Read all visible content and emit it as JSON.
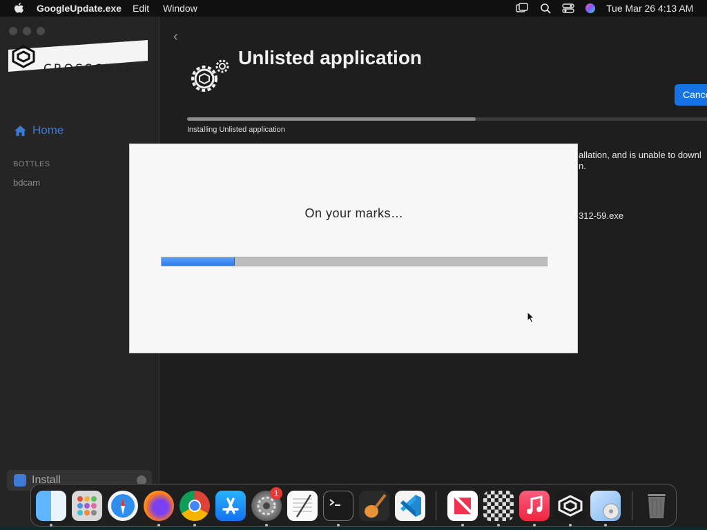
{
  "menubar": {
    "app_name": "GoogleUpdate.exe",
    "menus": [
      "Edit",
      "Window"
    ],
    "clock": "Tue Mar 26  4:13 AM",
    "icons": [
      "apple-icon",
      "screen-mirror-icon",
      "search-icon",
      "control-center-icon",
      "siri-icon"
    ]
  },
  "sidebar": {
    "logo_text": "CROSSOVER",
    "home_label": "Home",
    "section_label": "BOTTLES",
    "bottles": [
      "bdcam"
    ],
    "install_label": "Install"
  },
  "main": {
    "title": "Unlisted application",
    "cancel_label": "Cance",
    "status": "Installing Unlisted application",
    "progress": 0.55,
    "bg_text_line1": "allation, and is unable to downl",
    "bg_text_line2": "n.",
    "bg_text_line3": "312-59.exe"
  },
  "dialog": {
    "message": "On your marks…",
    "progress": 0.19
  },
  "dock": {
    "apps": [
      "Finder",
      "Launchpad",
      "Safari",
      "Firefox",
      "Chrome",
      "App Store",
      "System Settings",
      "TextEdit",
      "Terminal",
      "GarageBand",
      "VS Code",
      "News",
      "Chess",
      "Music",
      "CrossOver",
      "Installer",
      "Trash"
    ],
    "settings_badge": "1"
  },
  "colors": {
    "accent": "#1573e6",
    "sidebar_bg": "#252525",
    "window_bg": "#1e1e1e",
    "dialog_bg": "#f7f7f7",
    "progress_fill": "#2f7ae5"
  }
}
